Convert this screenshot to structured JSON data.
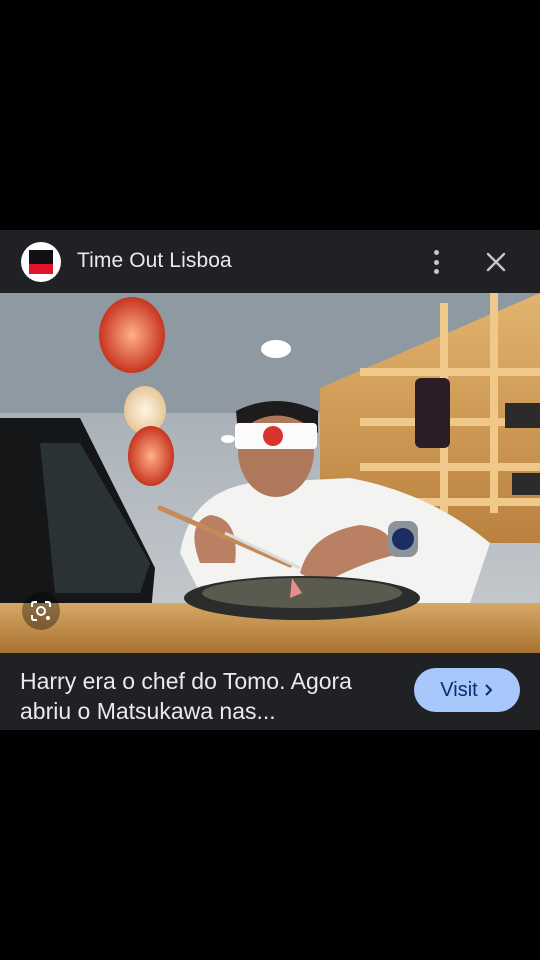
{
  "card": {
    "source_name": "Time Out Lisboa",
    "caption": "Harry era o chef do Tomo. Agora abriu o Matsukawa nas...",
    "visit_label": "Visit",
    "icons": {
      "logo": "time-out-logo",
      "more": "more-vert-icon",
      "close": "close-icon",
      "lens": "google-lens-icon",
      "visit_arrow": "chevron-right-icon"
    },
    "colors": {
      "card_bg": "#202124",
      "visit_bg": "#a8c7fa",
      "visit_text": "#062e6f",
      "logo_red": "#e0142b"
    }
  }
}
